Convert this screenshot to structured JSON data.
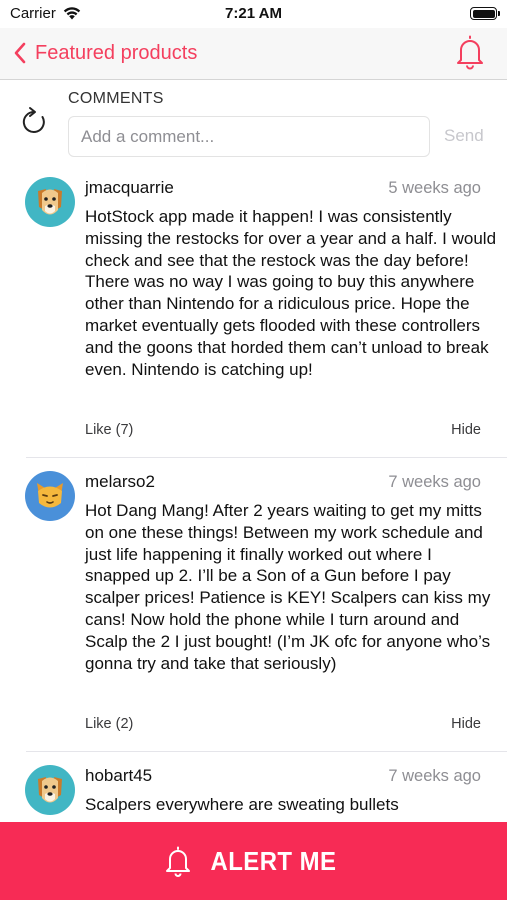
{
  "status_bar": {
    "carrier": "Carrier",
    "time": "7:21 AM"
  },
  "nav": {
    "back_label": "Featured products",
    "accent_color": "#f43f5e"
  },
  "comments_section": {
    "title": "COMMENTS",
    "input_placeholder": "Add a comment...",
    "send_label": "Send"
  },
  "comments": [
    {
      "username": "jmacquarrie",
      "time": "5 weeks ago",
      "avatar": "dog-avatar",
      "body": "HotStock app made it happen! I was consistently missing the restocks for over a year and a half. I would check and see that the restock was the day before! There was no way I was going to buy this anywhere other than Nintendo for a ridiculous price. Hope the market eventually gets flooded with these controllers and the goons that horded them can’t unload to break even. Nintendo is catching up!",
      "like_label": "Like (7)",
      "hide_label": "Hide"
    },
    {
      "username": "melarso2",
      "time": "7 weeks ago",
      "avatar": "cat-avatar",
      "body": "Hot Dang Mang! After 2 years waiting to get my mitts on one these things! Between my work schedule and just life happening it finally worked out where I snapped up 2. I’ll be a Son of a Gun before I pay scalper prices! Patience is KEY! Scalpers can kiss my cans! Now hold the phone while I turn around and Scalp the 2 I just bought! (I’m JK ofc for anyone who’s gonna try and take that seriously)",
      "like_label": "Like (2)",
      "hide_label": "Hide"
    },
    {
      "username": "hobart45",
      "time": "7 weeks ago",
      "avatar": "dog-avatar",
      "body": "Scalpers everywhere are sweating bullets"
    }
  ],
  "alert_button": {
    "label": "ALERT ME",
    "color": "#f72b55"
  }
}
